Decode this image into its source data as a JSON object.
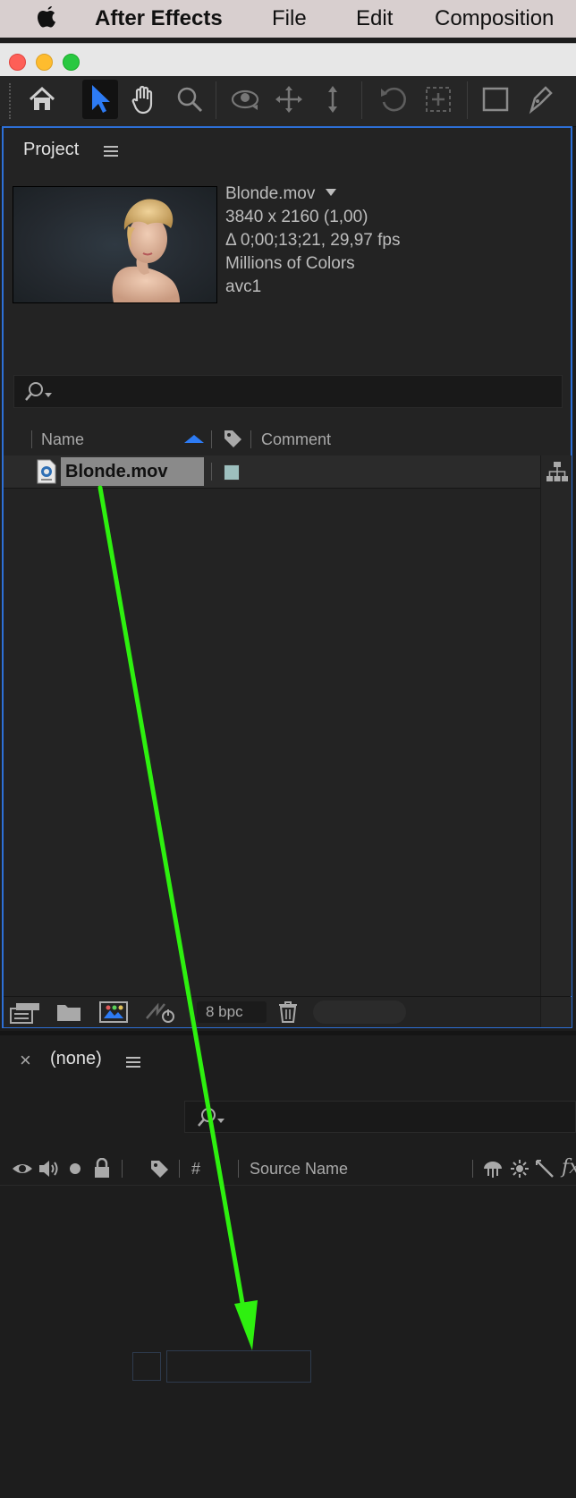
{
  "menubar": {
    "app": "After Effects",
    "items": [
      "File",
      "Edit",
      "Composition"
    ]
  },
  "toolbar": {
    "tools": [
      "home-icon",
      "selection-arrow-icon",
      "hand-icon",
      "zoom-icon",
      "orbit-camera-icon",
      "pan-camera-icon",
      "dolly-camera-icon",
      "rotate-icon",
      "pan-behind-icon",
      "rectangle-icon",
      "pen-icon"
    ],
    "selected": "selection-arrow-icon",
    "accent": "#2d7bf4"
  },
  "project": {
    "title": "Project",
    "footage": {
      "name": "Blonde.mov",
      "dimensions": "3840 x 2160 (1,00)",
      "duration": "Δ 0;00;13;21, 29,97 fps",
      "colors": "Millions of Colors",
      "codec": "avc1"
    },
    "columns": {
      "name": "Name",
      "comment": "Comment"
    },
    "items": [
      {
        "name": "Blonde.mov",
        "label_color": "#9dbfbe"
      }
    ],
    "footer": {
      "bpc": "8 bpc"
    },
    "border_color": "#2d6fd6"
  },
  "timeline": {
    "close": "×",
    "title": "(none)",
    "columns": {
      "hash": "#",
      "source_name": "Source Name"
    }
  },
  "annotation": {
    "arrow_color": "#2ef00f"
  }
}
